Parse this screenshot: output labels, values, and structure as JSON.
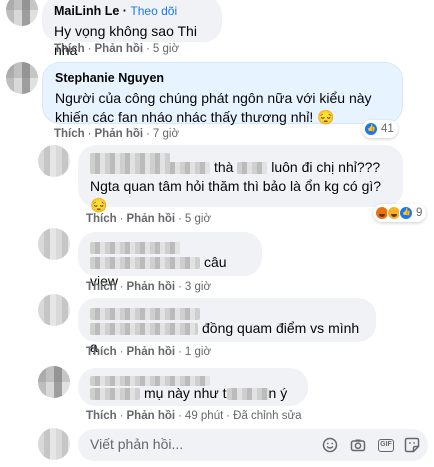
{
  "colors": {
    "link": "#1877f2",
    "bubble": "#f0f2f5",
    "highlight": "#e7f3ff",
    "meta": "#65676b"
  },
  "comments": [
    {
      "author": "MaiLinh Le",
      "follow": "Theo dõi",
      "text": "Hy vọng không sao Thi nha",
      "like": "Thích",
      "reply": "Phản hồi",
      "time": "5 giờ"
    },
    {
      "author": "Stephanie Nguyen",
      "text": "Người của công chúng phát ngôn nữa với kiểu này khiến các fan nháo nhác thấy thương nhỉ! 😔",
      "like": "Thích",
      "reply": "Phản hồi",
      "time": "7 giờ",
      "reaction_count": "41",
      "reaction_icons": [
        "like-icon"
      ]
    },
    {
      "text_a": "thà",
      "text_b": "luôn đi chị nhỉ??? Ngta quan tâm hỏi thăm thì bảo là ổn kg có gì?😔",
      "like": "Thích",
      "reply": "Phản hồi",
      "time": "5 giờ",
      "reaction_count": "9",
      "reaction_icons": [
        "angry-icon",
        "haha-icon",
        "like-icon"
      ]
    },
    {
      "text": "câu view",
      "like": "Thích",
      "reply": "Phản hồi",
      "time": "3 giờ"
    },
    {
      "text": "đồng quam điểm vs mình ạ",
      "like": "Thích",
      "reply": "Phản hồi",
      "time": "1 giờ"
    },
    {
      "text_a": "mụ này như t",
      "text_b": "n ý",
      "like": "Thích",
      "reply": "Phản hồi",
      "time": "49 phút",
      "edited": "Đã chỉnh sửa"
    }
  ],
  "composer": {
    "placeholder": "Viết phản hồi...",
    "icons": [
      "emoji-icon",
      "camera-icon",
      "gif-icon",
      "sticker-icon"
    ]
  }
}
